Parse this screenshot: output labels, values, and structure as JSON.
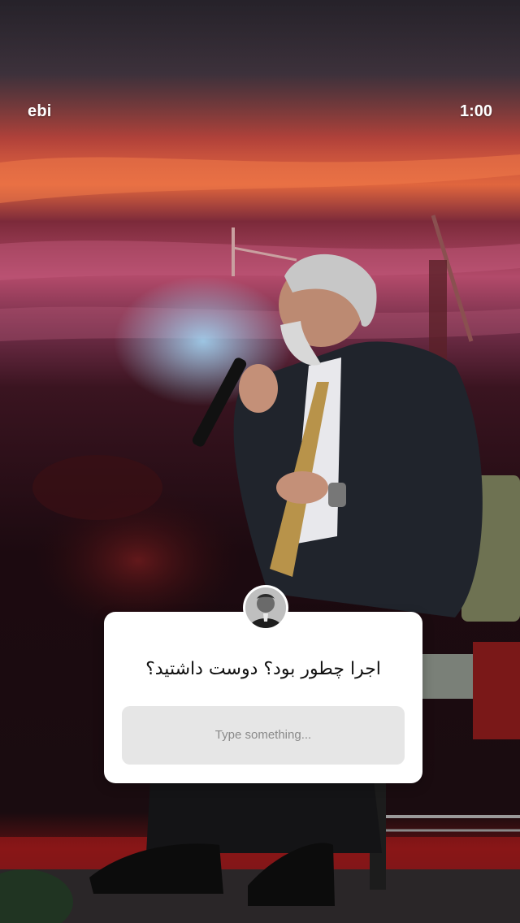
{
  "story": {
    "username": "ebi",
    "timer": "1:00"
  },
  "question_sticker": {
    "avatar": "profile-avatar",
    "question": "اجرا چطور بود؟ دوست داشتید؟",
    "answer_placeholder": "Type something..."
  },
  "colors": {
    "card_bg": "#ffffff",
    "field_bg": "#e6e6e6",
    "placeholder": "#8a8a8a",
    "text_primary": "#111111",
    "overlay_text": "#ffffff"
  }
}
